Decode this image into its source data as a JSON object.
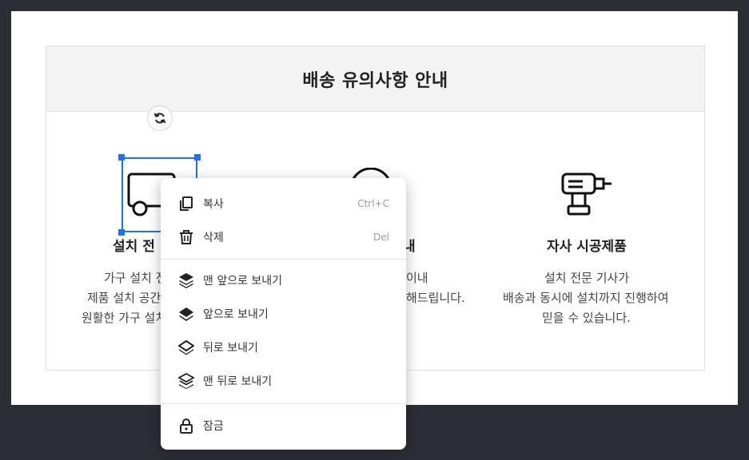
{
  "notice": {
    "title": "배송 유의사항 안내"
  },
  "columns": [
    {
      "title": "설치 전",
      "lines": [
        "가구 설치 전",
        "제품 설치 공간",
        "원활한 가구 설치"
      ]
    },
    {
      "title": "내",
      "lines": [
        "이내",
        "해드립니다."
      ]
    },
    {
      "title": "자사 시공제품",
      "lines": [
        "설치 전문 기사가",
        "배송과 동시에 설치까지 진행하여",
        "믿을 수 있습니다."
      ]
    }
  ],
  "context_menu": {
    "items": [
      {
        "label": "복사",
        "shortcut": "Ctrl+C",
        "icon": "copy-icon"
      },
      {
        "label": "삭제",
        "shortcut": "Del",
        "icon": "trash-icon"
      },
      {
        "label": "맨 앞으로 보내기",
        "icon": "bring-to-front-icon"
      },
      {
        "label": "앞으로 보내기",
        "icon": "bring-forward-icon"
      },
      {
        "label": "뒤로 보내기",
        "icon": "send-backward-icon"
      },
      {
        "label": "맨 뒤로 보내기",
        "icon": "send-to-back-icon"
      },
      {
        "label": "잠금",
        "icon": "lock-icon"
      }
    ]
  },
  "colors": {
    "selection": "#1e73e8",
    "background": "#2b2e35"
  }
}
